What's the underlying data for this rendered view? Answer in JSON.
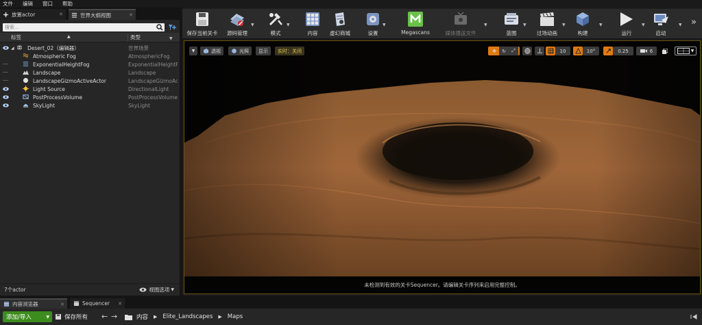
{
  "menu": [
    "文件",
    "编辑",
    "窗口",
    "帮助"
  ],
  "left_panel": {
    "tabs": [
      {
        "label": "放置actor",
        "icon": "place-actor-icon"
      },
      {
        "label": "世界大纲视图",
        "icon": "outliner-icon"
      }
    ],
    "search_placeholder": "搜索...",
    "columns": {
      "label": "标签",
      "type": "类型"
    },
    "rows": [
      {
        "label": "Desert_02（编辑器）",
        "type": "世界场景",
        "icon": "world-icon",
        "indent": 0
      },
      {
        "label": "Atmospheric Fog",
        "type": "AtmosphericFog",
        "icon": "fog-icon",
        "indent": 1
      },
      {
        "label": "ExponentialHeightFog",
        "type": "ExponentialHeightF",
        "icon": "height-fog-icon",
        "indent": 1
      },
      {
        "label": "Landscape",
        "type": "Landscape",
        "icon": "landscape-icon",
        "indent": 1
      },
      {
        "label": "LandscapeGizmoActiveActor",
        "type": "LandscapeGizmoAc",
        "icon": "gizmo-icon",
        "indent": 1
      },
      {
        "label": "Light Source",
        "type": "DirectionalLight",
        "icon": "directional-light-icon",
        "indent": 1
      },
      {
        "label": "PostProcessVolume",
        "type": "PostProcessVolume",
        "icon": "postprocess-icon",
        "indent": 1
      },
      {
        "label": "SkyLight",
        "type": "SkyLight",
        "icon": "skylight-icon",
        "indent": 1
      }
    ],
    "footer_count": "7个actor",
    "view_options": "视图选项"
  },
  "toolbar": {
    "buttons": [
      {
        "label": "保存当前关卡",
        "icon": "save-icon"
      },
      {
        "label": "源码管理",
        "icon": "source-control-icon"
      },
      {
        "label": "模式",
        "icon": "modes-icon"
      },
      {
        "label": "内容",
        "icon": "content-icon"
      },
      {
        "label": "虚幻商城",
        "icon": "marketplace-icon"
      },
      {
        "label": "设置",
        "icon": "settings-icon"
      },
      {
        "label": "Megascans",
        "icon": "megascans-icon"
      },
      {
        "label": "媒体播送文件",
        "icon": "media-icon"
      },
      {
        "label": "蓝图",
        "icon": "blueprint-icon"
      },
      {
        "label": "过场动画",
        "icon": "cinematics-icon"
      },
      {
        "label": "构建",
        "icon": "build-icon"
      },
      {
        "label": "运行",
        "icon": "play-icon"
      },
      {
        "label": "启动",
        "icon": "launch-icon"
      }
    ]
  },
  "viewport": {
    "perspective": "透视",
    "lit": "光照",
    "show": "显示",
    "realtime": "实时：关闭",
    "grid_snap": "10",
    "rotation_snap": "10°",
    "scale_snap": "0.25",
    "camera_speed": "6",
    "sequencer_message": "未检测到有效的关卡Sequencer。请编辑关卡序列来启用完整控制。"
  },
  "bottom_tabs": [
    {
      "label": "内容浏览器",
      "icon": "content-browser-icon"
    },
    {
      "label": "Sequencer",
      "icon": "sequencer-icon"
    }
  ],
  "content_bar": {
    "add_import": "添加/导入",
    "save_all": "保存所有",
    "breadcrumbs": [
      "内容",
      "Elite_Landscapes",
      "Maps"
    ]
  }
}
